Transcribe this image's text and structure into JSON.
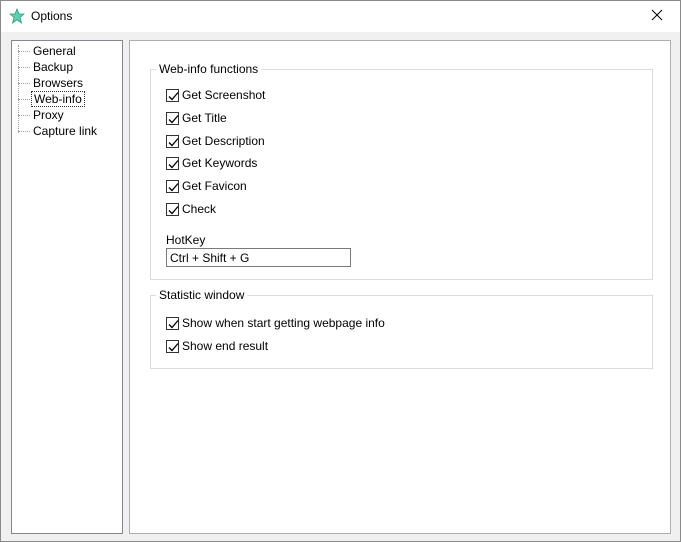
{
  "window": {
    "title": "Options",
    "app_icon": "star-icon",
    "accent_color": "#4fc3a1"
  },
  "nav": {
    "items": [
      {
        "label": "General",
        "selected": false
      },
      {
        "label": "Backup",
        "selected": false
      },
      {
        "label": "Browsers",
        "selected": false
      },
      {
        "label": "Web-info",
        "selected": true
      },
      {
        "label": "Proxy",
        "selected": false
      },
      {
        "label": "Capture link",
        "selected": false
      }
    ]
  },
  "webinfo": {
    "legend": "Web-info functions",
    "checkboxes": [
      {
        "label": "Get Screenshot",
        "checked": true
      },
      {
        "label": "Get Title",
        "checked": true
      },
      {
        "label": "Get Description",
        "checked": true
      },
      {
        "label": "Get Keywords",
        "checked": true
      },
      {
        "label": "Get Favicon",
        "checked": true
      },
      {
        "label": "Check",
        "checked": true
      }
    ],
    "hotkey_label": "HotKey",
    "hotkey_value": "Ctrl + Shift + G"
  },
  "statistic": {
    "legend": "Statistic window",
    "checkboxes": [
      {
        "label": "Show when start getting webpage info",
        "checked": true
      },
      {
        "label": "Show end result",
        "checked": true
      }
    ]
  }
}
